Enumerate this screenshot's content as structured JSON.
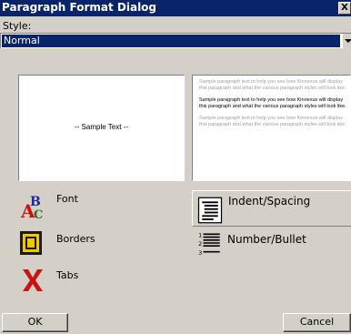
{
  "window": {
    "title": "Paragraph Format Dialog",
    "close_label": "X"
  },
  "style": {
    "label": "Style:",
    "selected": "Normal"
  },
  "preview": {
    "sample_text": "-- Sample Text --",
    "paragraph_before": "Sample paragraph text to help you see how Kinnexus will display this paragraph and what the various paragraph styles will look like.",
    "paragraph_current": "Sample paragraph text to help you see how Kinnexus will display this paragraph and what the various paragraph styles will look like.",
    "paragraph_after": "Sample paragraph text to help you see how Kinnexus will display this paragraph and what the various paragraph styles will look like."
  },
  "options": {
    "font": {
      "label": "Font",
      "icon": "font-icon"
    },
    "borders": {
      "label": "Borders",
      "icon": "borders-icon"
    },
    "tabs": {
      "label": "Tabs",
      "icon": "tabs-icon"
    },
    "indent_spacing": {
      "label": "Indent/Spacing",
      "icon": "indent-spacing-icon",
      "selected": true
    },
    "number_bullet": {
      "label": "Number/Bullet",
      "icon": "number-bullet-icon"
    }
  },
  "buttons": {
    "ok": "OK",
    "cancel": "Cancel"
  },
  "colors": {
    "titlebar": "#0a246a",
    "dialog_face": "#d4d0c8",
    "selection": "#0a246a"
  }
}
